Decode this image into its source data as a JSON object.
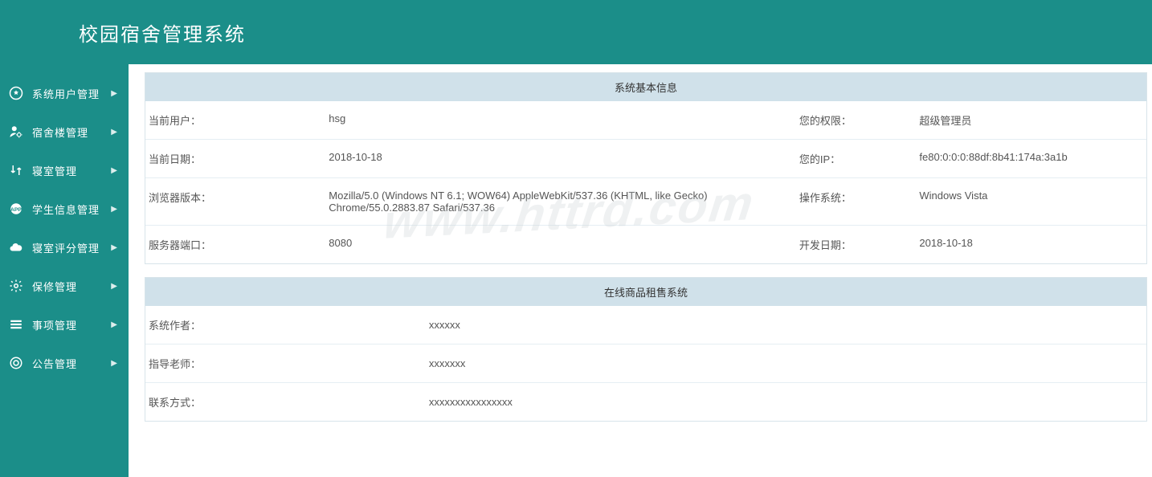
{
  "header": {
    "title": "校园宿舍管理系统"
  },
  "sidebar": {
    "items": [
      {
        "label": "系统用户管理"
      },
      {
        "label": "宿舍楼管理"
      },
      {
        "label": "寝室管理"
      },
      {
        "label": "学生信息管理"
      },
      {
        "label": "寝室评分管理"
      },
      {
        "label": "保修管理"
      },
      {
        "label": "事项管理"
      },
      {
        "label": "公告管理"
      }
    ]
  },
  "panels": {
    "sysinfo": {
      "title": "系统基本信息",
      "rows": [
        {
          "l1": "当前用户：",
          "v1": "hsg",
          "l2": "您的权限：",
          "v2": "超级管理员"
        },
        {
          "l1": "当前日期：",
          "v1": "2018-10-18",
          "l2": "您的IP：",
          "v2": "fe80:0:0:0:88df:8b41:174a:3a1b"
        },
        {
          "l1": "浏览器版本：",
          "v1": "Mozilla/5.0 (Windows NT 6.1; WOW64) AppleWebKit/537.36 (KHTML, like Gecko) Chrome/55.0.2883.87 Safari/537.36",
          "l2": "操作系统：",
          "v2": "Windows Vista"
        },
        {
          "l1": "服务器端口：",
          "v1": "8080",
          "l2": "开发日期：",
          "v2": "2018-10-18"
        }
      ]
    },
    "rental": {
      "title": "在线商品租售系统",
      "rows": [
        {
          "l": "系统作者：",
          "v": "xxxxxx"
        },
        {
          "l": "指导老师：",
          "v": "xxxxxxx"
        },
        {
          "l": "联系方式：",
          "v": "xxxxxxxxxxxxxxxx"
        }
      ]
    }
  },
  "watermark": "www.httrd.com"
}
